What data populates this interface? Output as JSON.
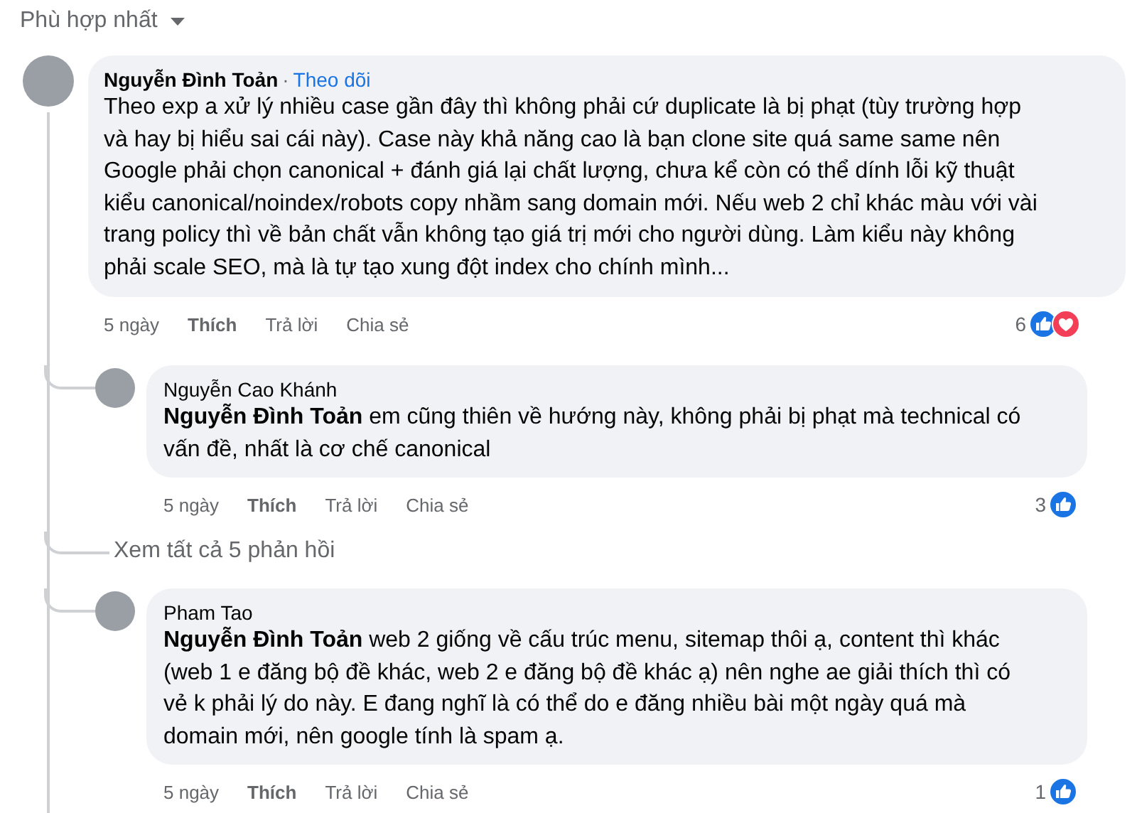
{
  "sort": {
    "label": "Phù hợp nhất"
  },
  "comment": {
    "author": "Nguyễn Đình Toản",
    "separator": "·",
    "follow": "Theo dõi",
    "text": "Theo exp a xử lý nhiều case gần đây thì không phải cứ duplicate là bị phạt (tùy trường hợp và hay bị hiểu sai cái này). Case này khả năng cao là bạn clone site quá same same nên Google phải chọn canonical + đánh giá lại chất lượng, chưa kể còn có thể dính lỗi kỹ thuật kiểu canonical/noindex/robots copy nhầm sang domain mới. Nếu web 2 chỉ khác màu với vài trang policy thì về bản chất vẫn không tạo giá trị mới cho người dùng. Làm kiểu này không phải scale SEO, mà là tự tạo xung đột index cho chính mình...",
    "time": "5 ngày",
    "actions": [
      "Thích",
      "Trả lời",
      "Chia sẻ"
    ],
    "reactions": {
      "count": "6",
      "icons": [
        {
          "kind": "like"
        },
        {
          "kind": "love"
        }
      ]
    }
  },
  "thread": [
    {
      "kind": "reply",
      "author": "Nguyễn Cao Khánh",
      "text": "**Nguyễn Đình Toản** em cũng thiên về hướng này, không phải bị phạt mà technical có vấn đề, nhất là cơ chế canonical",
      "time": "5 ngày",
      "actions": [
        "Thích",
        "Trả lời",
        "Chia sẻ"
      ],
      "reactions": {
        "count": "3",
        "icons": [
          {
            "kind": "like"
          }
        ]
      }
    },
    {
      "kind": "more",
      "text": "Xem tất cả 5 phản hồi"
    },
    {
      "kind": "reply",
      "author": "Pham Tao",
      "text": "**Nguyễn Đình Toản** web 2 giống về cấu trúc menu, sitemap thôi ạ, content thì khác (web 1 e đăng bộ đề khác, web 2 e đăng bộ đề khác ạ) nên nghe ae giải thích thì có vẻ k phải lý do này. E đang nghĩ là có thể do e đăng nhiều bài một ngày quá mà domain mới, nên google tính là spam ạ.",
      "time": "5 ngày",
      "actions": [
        "Thích",
        "Trả lời",
        "Chia sẻ"
      ],
      "reactions": {
        "count": "1",
        "icons": [
          {
            "kind": "like"
          }
        ]
      }
    }
  ]
}
